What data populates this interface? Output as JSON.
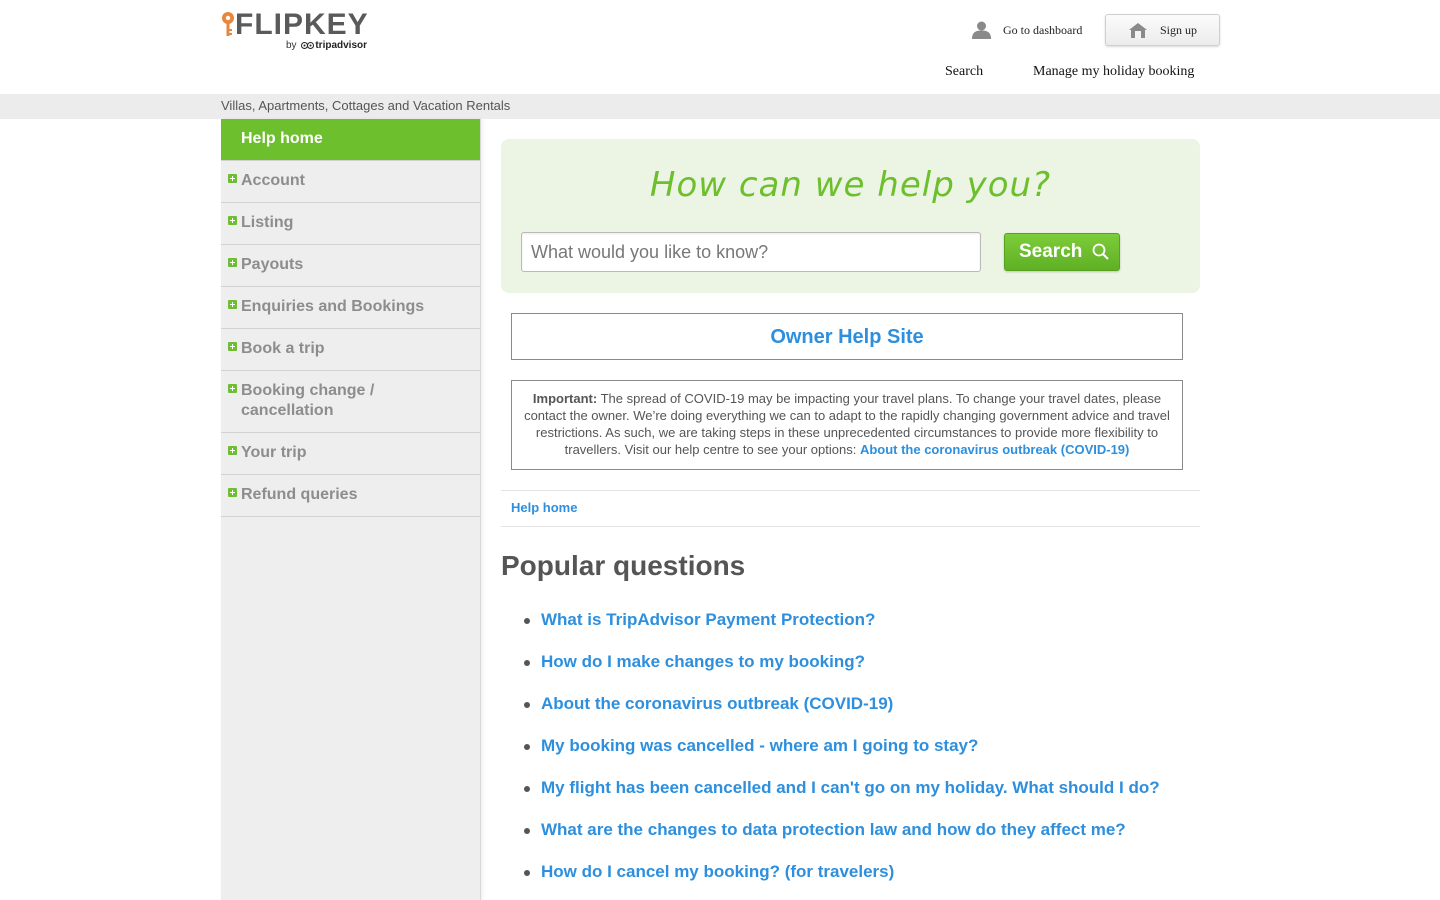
{
  "header": {
    "logo_text": "FLIPKEY",
    "logo_byline_prefix": "by",
    "logo_byline_brand": "tripadvisor",
    "dashboard_label": "Go to dashboard",
    "signup_label": "Sign up",
    "nav": {
      "search_label": "Search",
      "manage_label": "Manage my holiday booking"
    },
    "tagline": "Villas, Apartments, Cottages and Vacation Rentals"
  },
  "sidebar": {
    "home_label": "Help home",
    "items": [
      {
        "label": "Account"
      },
      {
        "label": "Listing"
      },
      {
        "label": "Payouts"
      },
      {
        "label": "Enquiries and Bookings"
      },
      {
        "label": "Book a trip"
      },
      {
        "label": "Booking change / cancellation"
      },
      {
        "label": "Your trip"
      },
      {
        "label": "Refund queries"
      }
    ]
  },
  "hero": {
    "title": "How can we help you?",
    "search_placeholder": "What would you like to know?",
    "search_button": "Search"
  },
  "owner_help": {
    "label": "Owner Help Site"
  },
  "notice": {
    "important_label": "Important:",
    "text": " The spread of COVID-19 may be impacting your travel plans. To change your travel dates, please contact the owner. We’re doing everything we can to adapt to the rapidly changing government advice and travel restrictions. As such, we are taking steps in these unprecedented circumstances to provide more flexibility to travellers. Visit our help centre to see your options: ",
    "link_label": "About the coronavirus outbreak (COVID-19)"
  },
  "breadcrumb": {
    "home_label": "Help home"
  },
  "popular": {
    "title": "Popular questions",
    "questions": [
      {
        "label": "What is TripAdvisor Payment Protection?"
      },
      {
        "label": "How do I make changes to my booking?"
      },
      {
        "label": "About the coronavirus outbreak (COVID-19)"
      },
      {
        "label": "My booking was cancelled - where am I going to stay?"
      },
      {
        "label": "My flight has been cancelled and I can't go on my holiday. What should I do?"
      },
      {
        "label": "What are the changes to data protection law and how do they affect me?"
      },
      {
        "label": "How do I cancel my booking? (for travelers)"
      }
    ]
  },
  "colors": {
    "brand_green": "#6dbf2d",
    "link_blue": "#2d8fdd",
    "logo_orange": "#e8863a"
  },
  "icons": {
    "dashboard": "user-icon",
    "signup": "house-icon",
    "search": "magnifier-icon",
    "sidebar_expand": "plus-icon"
  }
}
